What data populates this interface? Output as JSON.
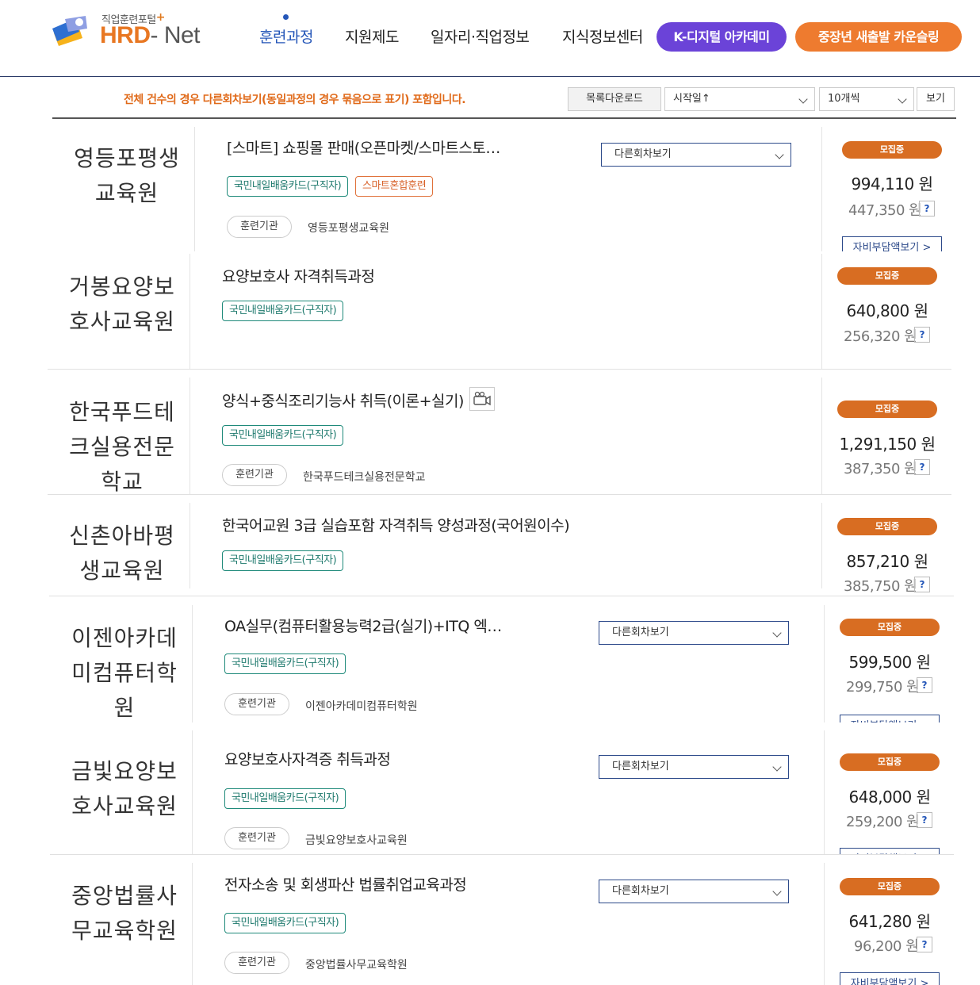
{
  "header": {
    "logo_sub": "직업훈련포털",
    "logo_plus": "+",
    "logo_hrd": "HRD",
    "logo_net": "- Net",
    "nav": [
      "훈련과정",
      "지원제도",
      "일자리·직업정보",
      "지식정보센터"
    ],
    "pill_k": "K-디지털 아카데미",
    "pill_m": "중장년 새출발 카운슬링",
    "accent": "#2456b8"
  },
  "toolbar": {
    "notice": "전체 건수의 경우 다른회차보기(동일과정의 경우 묶음으로 표기) 포함입니다.",
    "download": "목록다운로드",
    "sort": "시작일↑",
    "per_page": "10개씩",
    "view": "보기"
  },
  "labels": {
    "round": "다른회차보기",
    "status": "모집중",
    "institution": "훈련기관",
    "self_pay": "자비부담액보기 >",
    "question": "?"
  },
  "cards": [
    {
      "inst_lines": [
        "영등포평생",
        "교육원"
      ],
      "title": "[스마트] 쇼핑몰 판매(오픈마켓/스마트스토…",
      "tags": [
        "국민내일배움카드(구직자)",
        "스마트혼합훈련"
      ],
      "inst_small": "영등포평생교육원",
      "price": "994,110 원",
      "subprice": "447,350 원"
    },
    {
      "inst_lines": [
        "거봉요양보",
        "호사교육원"
      ],
      "title": "요양보호사 자격취득과정",
      "tags": [
        "국민내일배움카드(구직자)"
      ],
      "inst_small": "",
      "price": "640,800 원",
      "subprice": "256,320 원"
    },
    {
      "inst_lines": [
        "한국푸드테",
        "크실용전문",
        "학교"
      ],
      "title": "양식+중식조리기능사 취득(이론+실기)",
      "tags": [
        "국민내일배움카드(구직자)"
      ],
      "inst_small": "한국푸드테크실용전문학교",
      "price": "1,291,150 원",
      "subprice": "387,350 원"
    },
    {
      "inst_lines": [
        "신촌아바평",
        "생교육원"
      ],
      "title": "한국어교원 3급 실습포함 자격취득 양성과정(국어원이수)",
      "tags": [
        "국민내일배움카드(구직자)"
      ],
      "inst_small": "",
      "price": "857,210 원",
      "subprice": "385,750 원"
    },
    {
      "inst_lines": [
        "이젠아카데",
        "미컴퓨터학",
        "원"
      ],
      "title": "OA실무(컴퓨터활용능력2급(실기)+ITQ 엑…",
      "tags": [
        "국민내일배움카드(구직자)"
      ],
      "inst_small": "이젠아카데미컴퓨터학원",
      "price": "599,500 원",
      "subprice": "299,750 원"
    },
    {
      "inst_lines": [
        "금빛요양보",
        "호사교육원"
      ],
      "title": "요양보호사자격증 취득과정",
      "tags": [
        "국민내일배움카드(구직자)"
      ],
      "inst_small": "금빛요양보호사교육원",
      "price": "648,000 원",
      "subprice": "259,200 원"
    },
    {
      "inst_lines": [
        "중앙법률사",
        "무교육학원"
      ],
      "title": "전자소송 및 회생파산 법률취업교육과정",
      "tags": [
        "국민내일배움카드(구직자)"
      ],
      "inst_small": "중앙법률사무교육학원",
      "price": "641,280 원",
      "subprice": "96,200 원"
    }
  ]
}
